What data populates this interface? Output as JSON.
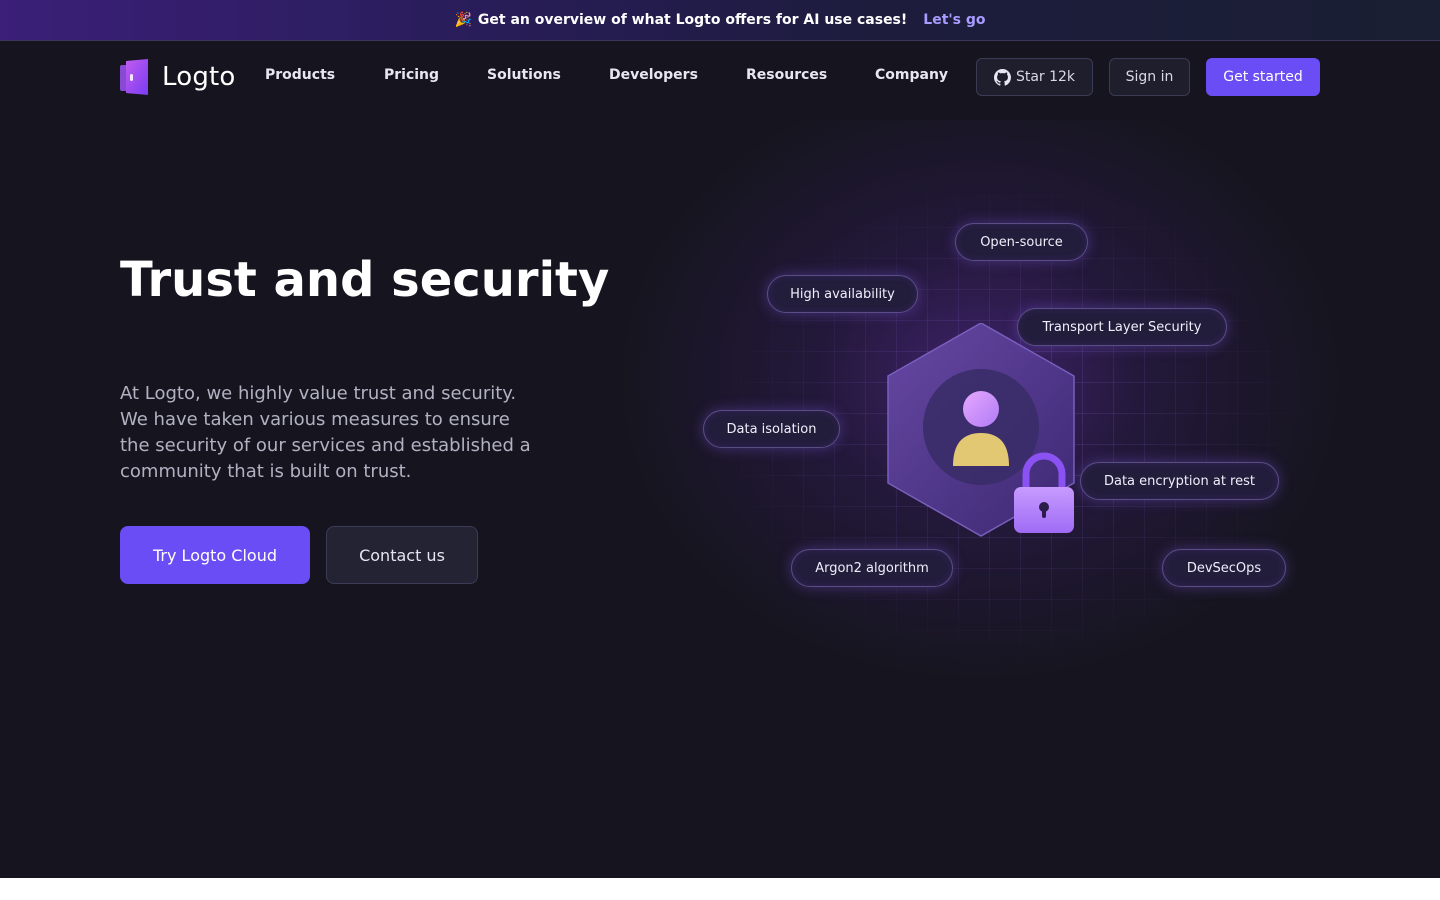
{
  "announcement": {
    "emoji": "🎉",
    "text": "Get an overview of what Logto offers for AI use cases!",
    "link": "Let's go"
  },
  "header": {
    "logo_text": "Logto",
    "nav": [
      {
        "label": "Products"
      },
      {
        "label": "Pricing"
      },
      {
        "label": "Solutions"
      },
      {
        "label": "Developers"
      },
      {
        "label": "Resources"
      },
      {
        "label": "Company"
      }
    ],
    "star_label": "Star 12k",
    "signin_label": "Sign in",
    "getstarted_label": "Get started"
  },
  "hero": {
    "title": "Trust and security",
    "description": "At Logto, we highly value trust and security. We have taken various measures to ensure the security of our services and established a community that is built on trust.",
    "primary_cta": "Try Logto Cloud",
    "secondary_cta": "Contact us"
  },
  "illustration": {
    "pills": [
      {
        "label": "Open-source"
      },
      {
        "label": "High availability"
      },
      {
        "label": "Transport Layer Security"
      },
      {
        "label": "Data isolation"
      },
      {
        "label": "Data encryption at rest"
      },
      {
        "label": "Argon2 algorithm"
      },
      {
        "label": "DevSecOps"
      }
    ]
  },
  "colors": {
    "background": "#16151f",
    "accent": "#6b4df5",
    "announcement_link": "#a89cff",
    "text_muted": "#b2b1c2"
  }
}
